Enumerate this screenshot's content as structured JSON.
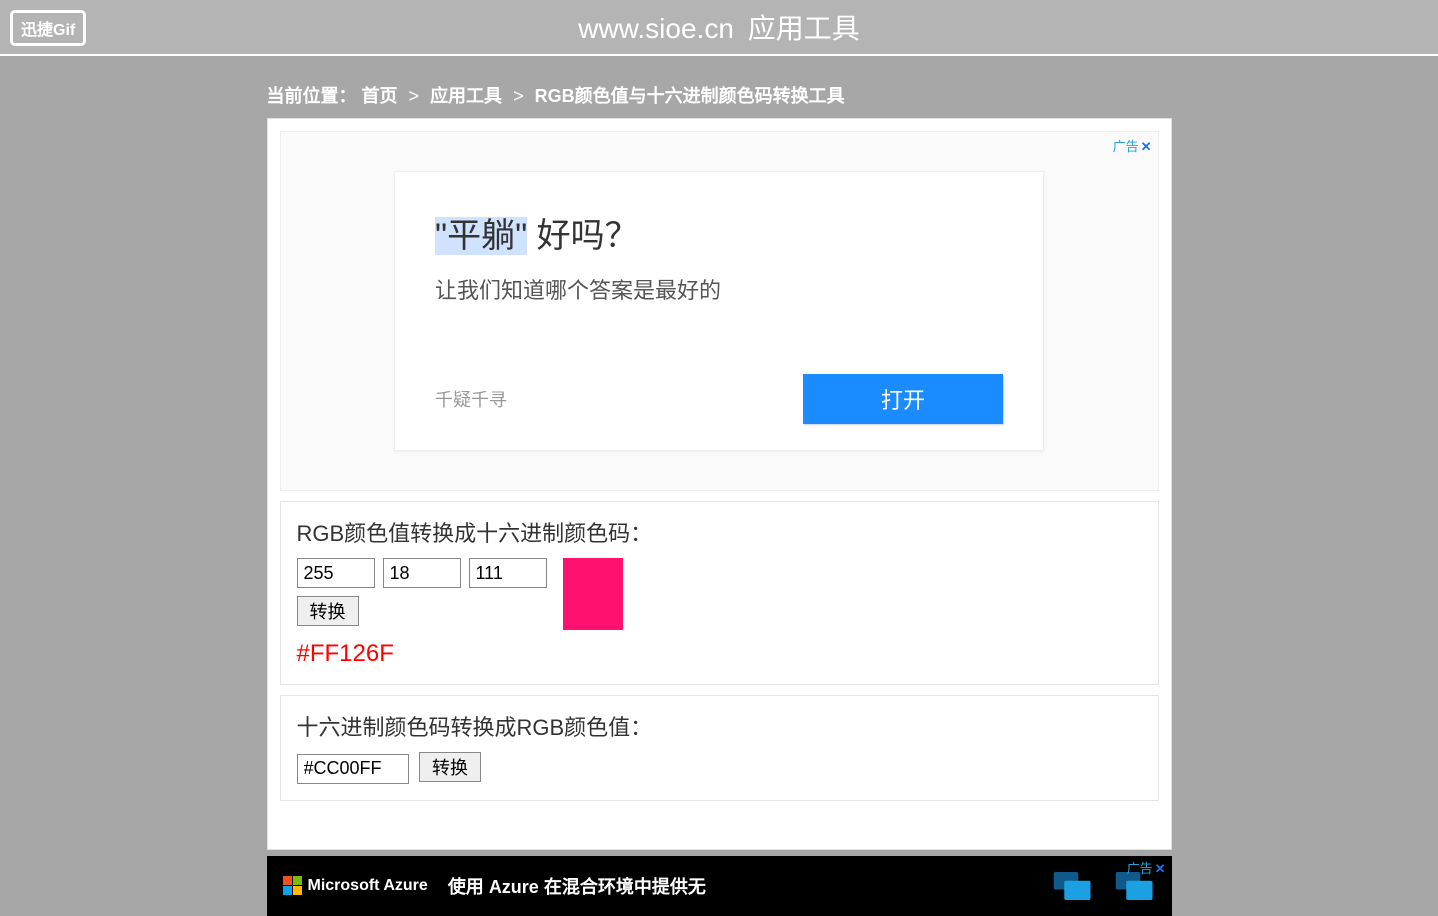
{
  "header": {
    "logo_text": "迅捷Gif",
    "title_domain": "www.sioe.cn",
    "title_label": "应用工具"
  },
  "breadcrumb": {
    "prefix": "当前位置：",
    "home": "首页",
    "tools": "应用工具",
    "current": "RGB颜色值与十六进制颜色码转换工具"
  },
  "ad1": {
    "tag": "广告",
    "headline_highlight": "\"平躺\"",
    "headline_rest": " 好吗？",
    "subtitle": "让我们知道哪个答案是最好的",
    "source": "千疑千寻",
    "cta": "打开"
  },
  "rgb_tool": {
    "label": "RGB颜色值转换成十六进制颜色码：",
    "r": "255",
    "g": "18",
    "b": "111",
    "convert_btn": "转换",
    "result_hex": "#FF126F",
    "swatch_color": "#ff126f"
  },
  "hex_tool": {
    "label": "十六进制颜色码转换成RGB颜色值：",
    "hex_value": "#CC00FF",
    "convert_btn": "转换"
  },
  "footer_ad": {
    "tag": "广告",
    "brand": "Microsoft Azure",
    "text": "使用 Azure 在混合环境中提供无"
  }
}
